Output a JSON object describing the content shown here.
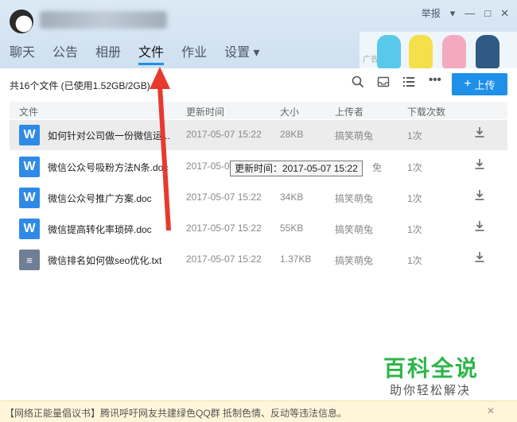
{
  "window": {
    "report_label": "举报",
    "controls": [
      "▾",
      "—",
      "□",
      "✕"
    ]
  },
  "tabs": [
    {
      "label": "聊天"
    },
    {
      "label": "公告"
    },
    {
      "label": "相册"
    },
    {
      "label": "文件"
    },
    {
      "label": "作业"
    },
    {
      "label": "设置 ▾"
    }
  ],
  "ad": {
    "tag": "广告"
  },
  "toolbar": {
    "file_count": "共16个文件 (已使用1.52GB/2GB)",
    "upload_label": "上传"
  },
  "table": {
    "columns": [
      "文件",
      "更新时间",
      "大小",
      "上传者",
      "下载次数"
    ],
    "rows": [
      {
        "name": "如何针对公司做一份微信运...",
        "time": "2017-05-07 15:22",
        "size": "28KB",
        "uploader": "搞笑萌兔",
        "downloads": "1次",
        "type": "W"
      },
      {
        "name": "微信公众号吸粉方法N条.doc",
        "time": "2017-05-0",
        "size": "",
        "uploader": "免",
        "downloads": "1次",
        "type": "W"
      },
      {
        "name": "微信公众号推广方案.doc",
        "time": "2017-05-07 15:22",
        "size": "34KB",
        "uploader": "搞笑萌兔",
        "downloads": "1次",
        "type": "W"
      },
      {
        "name": "微信提高转化率琐碎.doc",
        "time": "2017-05-07 15:22",
        "size": "55KB",
        "uploader": "搞笑萌兔",
        "downloads": "1次",
        "type": "W"
      },
      {
        "name": "微信排名如何做seo优化.txt",
        "time": "2017-05-07 15:22",
        "size": "1.37KB",
        "uploader": "搞笑萌兔",
        "downloads": "1次",
        "type": "≡"
      }
    ]
  },
  "tooltip": "更新时间：2017-05-07 15:22",
  "watermark": {
    "main": "百科全说",
    "sub": "助你轻松解决"
  },
  "notice": {
    "text": "【网络正能量倡议书】腾讯呼吁网友共建绿色QQ群 抵制色情、反动等违法信息。",
    "close": "✕"
  },
  "colors": {
    "accent": "#1e90e8",
    "arrow": "#e8392e",
    "watermark": "#2db54a"
  }
}
